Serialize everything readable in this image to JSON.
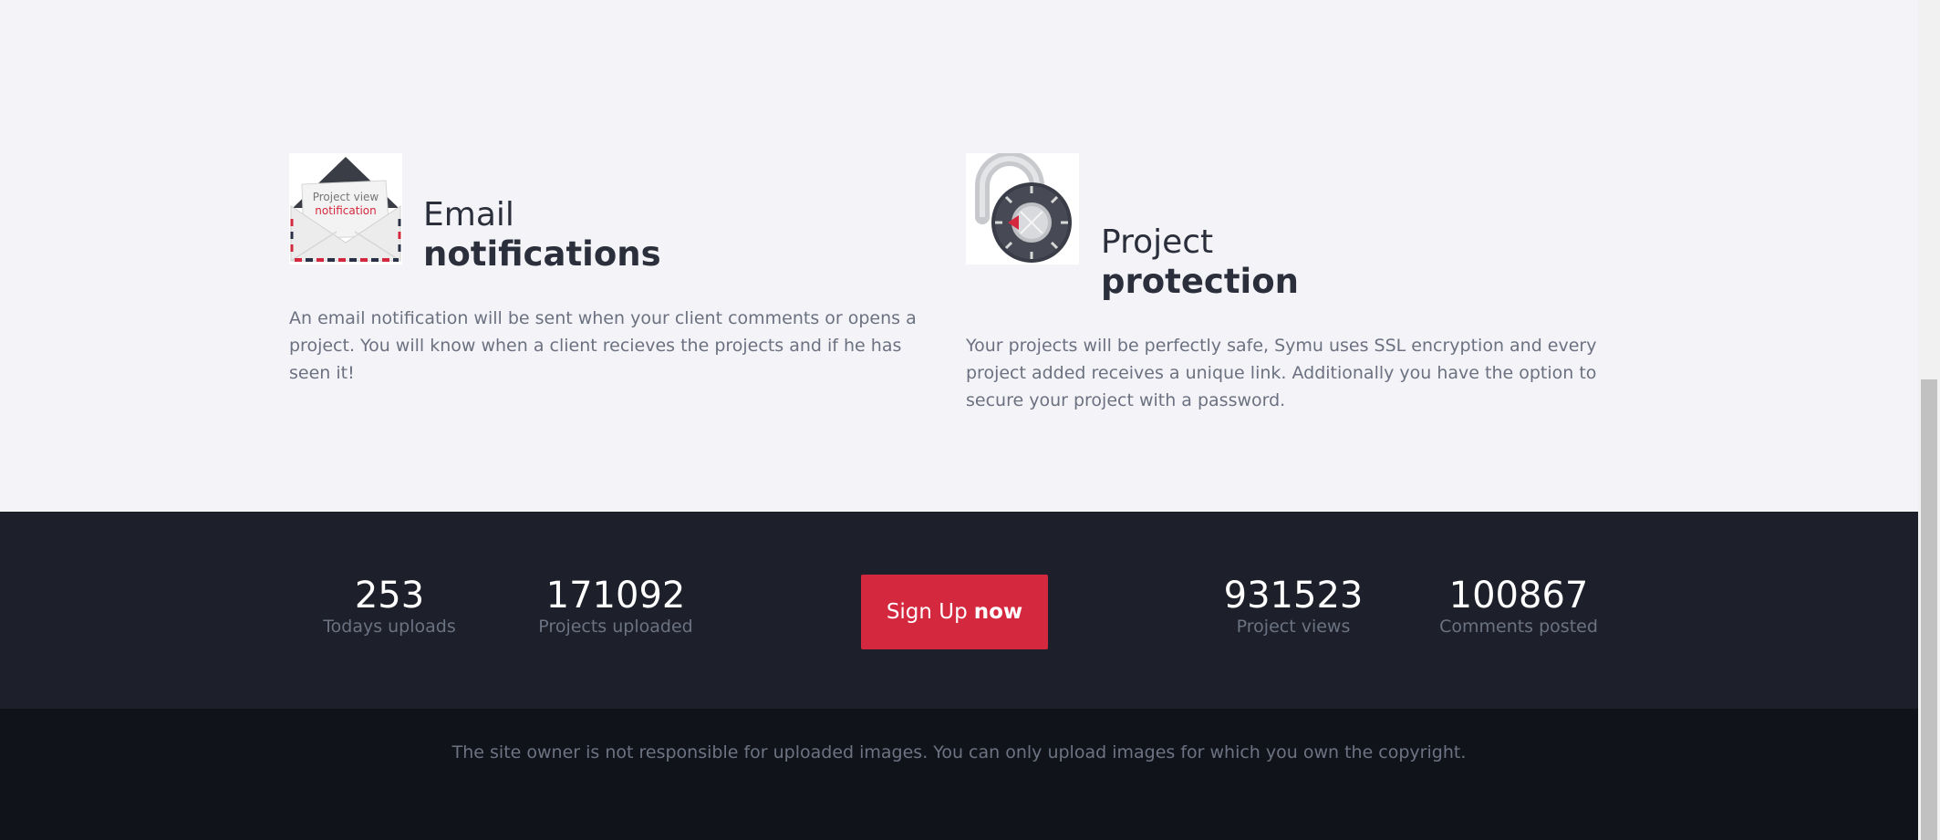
{
  "features": [
    {
      "id": "email",
      "icon_caption_line1": "Project view",
      "icon_caption_line2": "notification",
      "title_light": "Email",
      "title_bold": "notifications",
      "description": "An email notification will be sent when your client comments or opens a project. You will know when a client recieves the projects and if he has seen it!"
    },
    {
      "id": "protection",
      "title_light": "Project",
      "title_bold": "protection",
      "description": "Your projects will be perfectly safe, Symu uses SSL encryption and every project added receives a unique link. Additionally you have the option to secure your project with a password."
    }
  ],
  "stats": {
    "todays_uploads": {
      "value": "253",
      "label": "Todays uploads"
    },
    "projects_uploaded": {
      "value": "171092",
      "label": "Projects uploaded"
    },
    "project_views": {
      "value": "931523",
      "label": "Project views"
    },
    "comments_posted": {
      "value": "100867",
      "label": "Comments posted"
    }
  },
  "signup": {
    "label_regular": "Sign Up",
    "label_bold": "now"
  },
  "footer": {
    "disclaimer": "The site owner is not responsible for uploaded images. You can only upload images for which you own the copyright."
  },
  "colors": {
    "page_bg": "#f4f4f8",
    "stats_bg": "#1d202a",
    "footer_bg": "#10131a",
    "accent": "#d4283e"
  },
  "icons": {
    "email": "envelope-notification-icon",
    "protection": "combination-lock-icon"
  }
}
